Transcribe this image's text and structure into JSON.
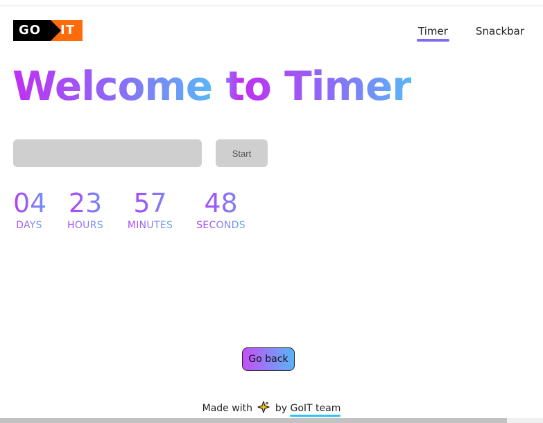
{
  "logo": {
    "left_text": "GO",
    "right_text": "IT",
    "brand_color": "#ff6b0a"
  },
  "nav": {
    "items": [
      {
        "label": "Timer",
        "active": true
      },
      {
        "label": "Snackbar",
        "active": false
      }
    ],
    "active_underline_color": "#7b6cf2"
  },
  "hero": {
    "title": "Welcome to Timer"
  },
  "form": {
    "input_value": "",
    "input_placeholder": "",
    "start_label": "Start"
  },
  "timer": {
    "units": [
      {
        "value": "04",
        "label": "DAYS"
      },
      {
        "value": "23",
        "label": "HOURS"
      },
      {
        "value": "57",
        "label": "MINUTES"
      },
      {
        "value": "48",
        "label": "SECONDS"
      }
    ]
  },
  "actions": {
    "go_back_label": "Go back"
  },
  "footer": {
    "made_with": "Made with",
    "icon": "sparkle-star-icon",
    "by": "by",
    "team_link": "GoIT team"
  },
  "colors": {
    "gradient_start": "#c12ff3",
    "gradient_mid": "#8b6cf6",
    "gradient_end": "#58b8f6"
  }
}
